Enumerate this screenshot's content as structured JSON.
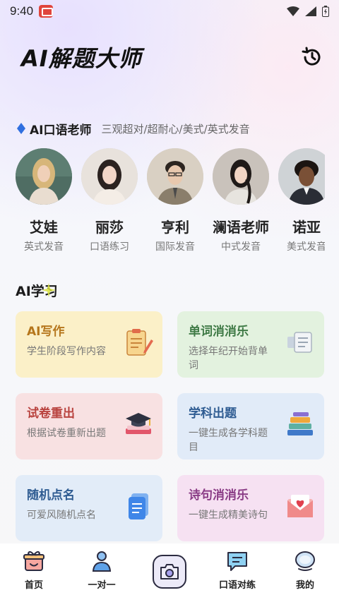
{
  "status_bar": {
    "time": "9:40"
  },
  "header": {
    "title": "AI解题大师"
  },
  "tutor": {
    "title": "AI口语老师",
    "subtitle": "三观超对/超耐心/美式/英式发音",
    "teachers": [
      {
        "name": "艾娃",
        "tag": "英式发音"
      },
      {
        "name": "丽莎",
        "tag": "口语练习"
      },
      {
        "name": "亨利",
        "tag": "国际发音"
      },
      {
        "name": "澜语老师",
        "tag": "中式发音"
      },
      {
        "name": "诺亚",
        "tag": "美式发音"
      }
    ]
  },
  "learning": {
    "title": "AI学习",
    "cards": [
      {
        "title": "AI写作",
        "desc": "学生阶段写作内容",
        "icon": "clipboard-pencil-icon"
      },
      {
        "title": "单词消消乐",
        "desc": "选择年纪开始背单词",
        "icon": "flashcards-icon"
      },
      {
        "title": "试卷重出",
        "desc": "根据试卷重新出题",
        "icon": "graduation-cap-book-icon"
      },
      {
        "title": "学科出题",
        "desc": "一键生成各学科题目",
        "icon": "book-stack-icon"
      },
      {
        "title": "随机点名",
        "desc": "可爱风随机点名",
        "icon": "document-icon"
      },
      {
        "title": "诗句消消乐",
        "desc": "一键生成精美诗句",
        "icon": "envelope-heart-icon"
      }
    ]
  },
  "tabbar": {
    "tabs": [
      {
        "label": "首页",
        "icon": "home-gift-icon"
      },
      {
        "label": "一对一",
        "icon": "person-icon"
      },
      {
        "label": "",
        "icon": "camera-icon"
      },
      {
        "label": "口语对练",
        "icon": "chat-icon"
      },
      {
        "label": "我的",
        "icon": "profile-bubble-icon"
      }
    ]
  }
}
